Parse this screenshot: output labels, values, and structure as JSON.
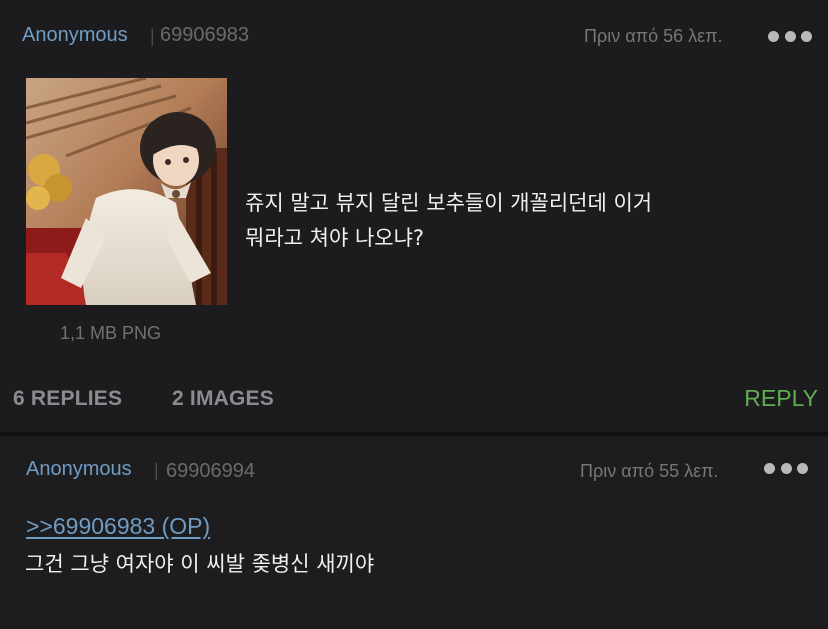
{
  "op_post": {
    "author": "Anonymous",
    "separator": "|",
    "post_id": "69906983",
    "timestamp": "Πριν από 56 λεπ.",
    "more_icon": "more-dots-icon",
    "image_icon": "anime-character-thumbnail",
    "file_info": "1,1 MB PNG",
    "text_lines": [
      "쥬지 말고 뷰지 달린 보추들이 개꼴리던데 이거",
      "뭐라고 쳐야 나오냐?"
    ],
    "replies_count": "6 REPLIES",
    "images_count": "2 IMAGES",
    "reply_label": "REPLY"
  },
  "reply_post": {
    "author": "Anonymous",
    "separator": "|",
    "post_id": "69906994",
    "timestamp": "Πριν από 55 λεπ.",
    "more_icon": "more-dots-icon",
    "quote_link": ">>69906983 (OP)",
    "text": "그건 그냥 여자야 이 씨발 좆병신 새끼야"
  },
  "colors": {
    "background": "#1c1c1e",
    "name": "#6f9cc4",
    "reply_button": "#5fae52",
    "muted": "#77777a"
  }
}
